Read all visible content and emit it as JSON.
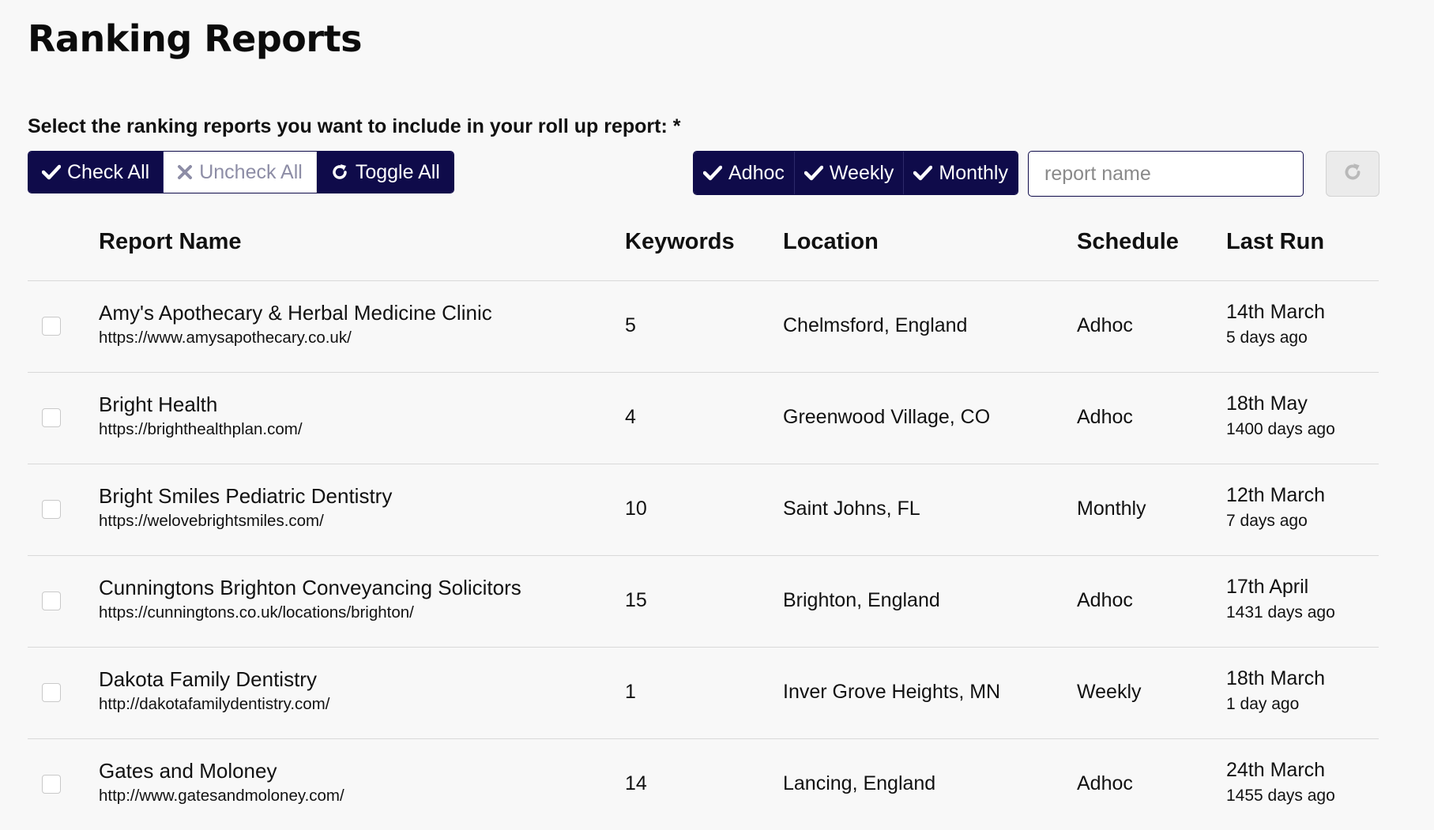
{
  "page": {
    "title": "Ranking Reports"
  },
  "instruction": "Select the ranking reports you want to include in your roll up report: *",
  "bulk_actions": [
    {
      "label": "Check All",
      "icon": "check-icon"
    },
    {
      "label": "Uncheck All",
      "icon": "x-icon"
    },
    {
      "label": "Toggle All",
      "icon": "refresh-icon"
    }
  ],
  "schedule_filters": [
    {
      "label": "Adhoc",
      "icon": "check-icon"
    },
    {
      "label": "Weekly",
      "icon": "check-icon"
    },
    {
      "label": "Monthly",
      "icon": "check-icon"
    }
  ],
  "search": {
    "placeholder": "report name",
    "value": ""
  },
  "colors": {
    "navy": "#0f0b4a",
    "muted": "#8d8da6",
    "border": "#d9d9d9"
  },
  "table": {
    "headers": [
      "Report Name",
      "Keywords",
      "Location",
      "Schedule",
      "Last Run"
    ],
    "rows": [
      {
        "name": "Amy's Apothecary & Herbal Medicine Clinic",
        "url": "https://www.amysapothecary.co.uk/",
        "keywords": "5",
        "location": "Chelmsford, England",
        "schedule": "Adhoc",
        "last_run_date": "14th March",
        "last_run_ago": "5 days ago"
      },
      {
        "name": "Bright Health",
        "url": "https://brighthealthplan.com/",
        "keywords": "4",
        "location": "Greenwood Village, CO",
        "schedule": "Adhoc",
        "last_run_date": "18th May",
        "last_run_ago": "1400 days ago"
      },
      {
        "name": "Bright Smiles Pediatric Dentistry",
        "url": "https://welovebrightsmiles.com/",
        "keywords": "10",
        "location": "Saint Johns, FL",
        "schedule": "Monthly",
        "last_run_date": "12th March",
        "last_run_ago": "7 days ago"
      },
      {
        "name": "Cunningtons Brighton Conveyancing Solicitors",
        "url": "https://cunningtons.co.uk/locations/brighton/",
        "keywords": "15",
        "location": "Brighton, England",
        "schedule": "Adhoc",
        "last_run_date": "17th April",
        "last_run_ago": "1431 days ago"
      },
      {
        "name": "Dakota Family Dentistry",
        "url": "http://dakotafamilydentistry.com/",
        "keywords": "1",
        "location": "Inver Grove Heights, MN",
        "schedule": "Weekly",
        "last_run_date": "18th March",
        "last_run_ago": "1 day ago"
      },
      {
        "name": "Gates and Moloney",
        "url": "http://www.gatesandmoloney.com/",
        "keywords": "14",
        "location": "Lancing, England",
        "schedule": "Adhoc",
        "last_run_date": "24th March",
        "last_run_ago": "1455 days ago"
      }
    ]
  }
}
